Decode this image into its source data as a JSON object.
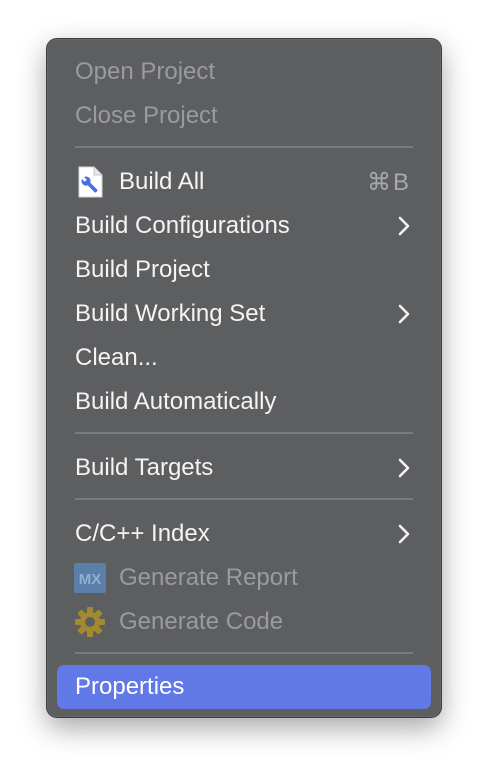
{
  "menu": {
    "items": [
      {
        "label": "Open Project",
        "enabled": false
      },
      {
        "label": "Close Project",
        "enabled": false
      },
      {
        "label": "Build All",
        "enabled": true,
        "icon": "build-file-icon",
        "shortcut": "⌘B"
      },
      {
        "label": "Build Configurations",
        "enabled": true,
        "submenu": true
      },
      {
        "label": "Build Project",
        "enabled": true
      },
      {
        "label": "Build Working Set",
        "enabled": true,
        "submenu": true
      },
      {
        "label": "Clean...",
        "enabled": true
      },
      {
        "label": "Build Automatically",
        "enabled": true
      },
      {
        "label": "Build Targets",
        "enabled": true,
        "submenu": true
      },
      {
        "label": "C/C++ Index",
        "enabled": true,
        "submenu": true
      },
      {
        "label": "Generate Report",
        "enabled": false,
        "icon": "mx-icon"
      },
      {
        "label": "Generate Code",
        "enabled": false,
        "icon": "gear-icon"
      },
      {
        "label": "Properties",
        "enabled": true,
        "highlighted": true
      }
    ],
    "icons": {
      "mx_text": "MX"
    },
    "colors": {
      "background": "#5d5e60",
      "highlight": "#6079e6",
      "text": "#f4f4f5",
      "disabled_text": "#9a9b9d"
    }
  }
}
